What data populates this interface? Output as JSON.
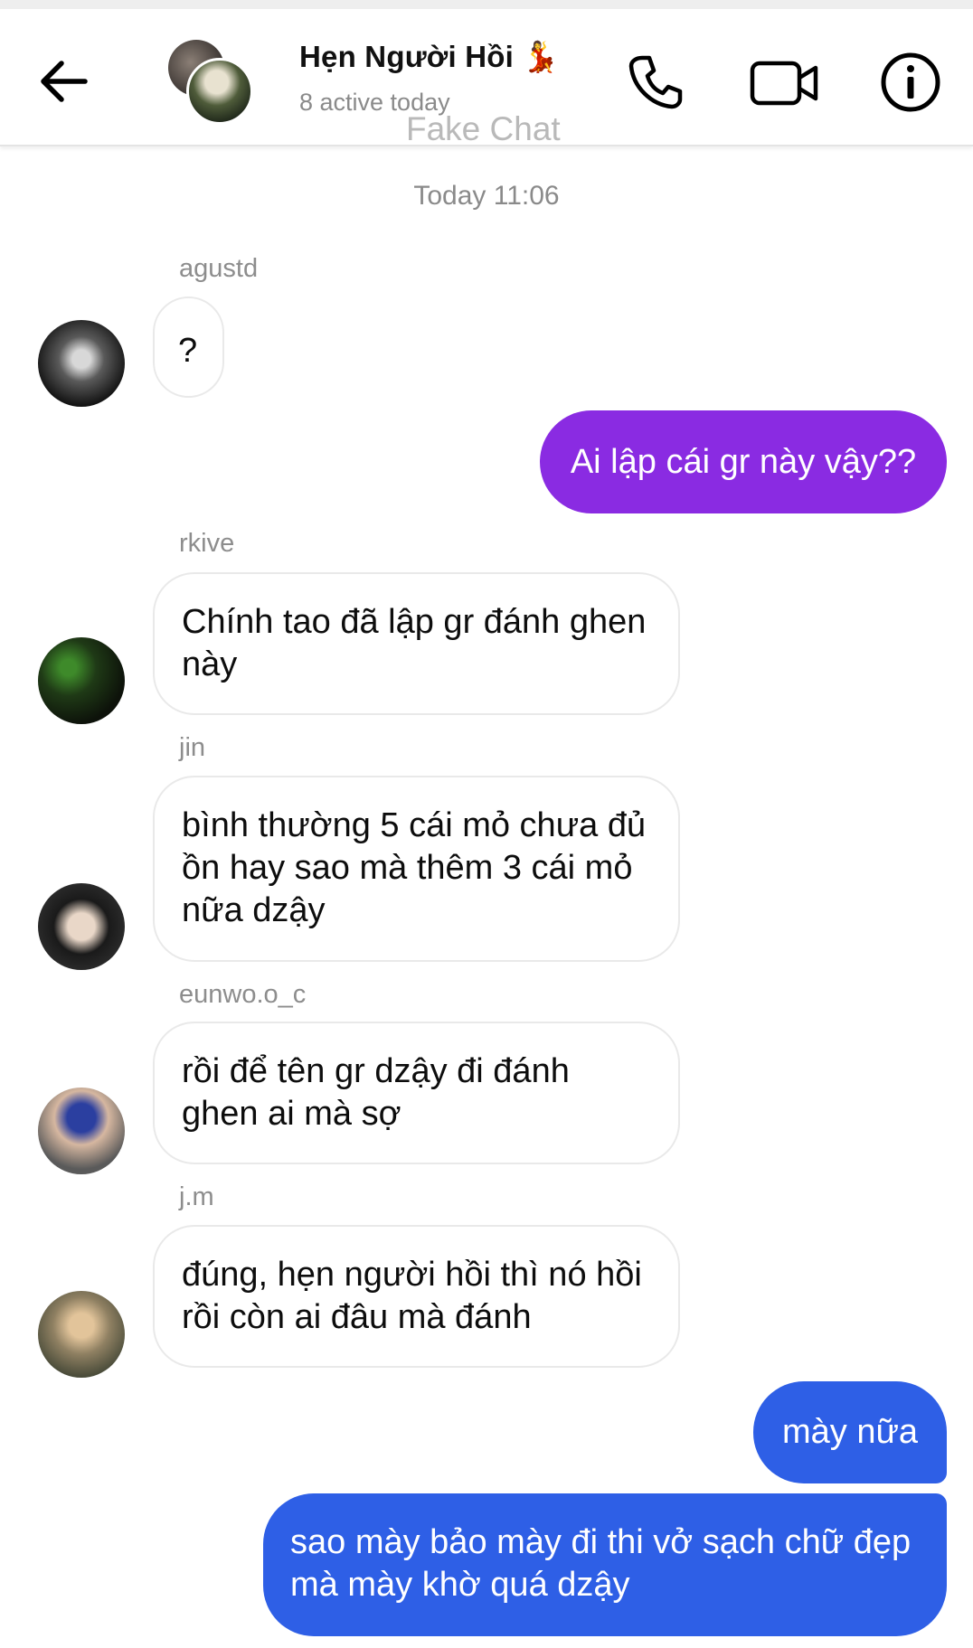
{
  "header": {
    "title": "Hẹn Người Hồi 💃",
    "subtitle": "8 active today",
    "watermark": "Fake Chat"
  },
  "icons": {
    "back": "back-arrow-icon",
    "call": "phone-icon",
    "video": "video-camera-icon",
    "info": "info-icon"
  },
  "colors": {
    "purple_bubble": "#8a2be2",
    "blue_bubble": "#2e5fe6",
    "incoming_border": "#e9e9e9"
  },
  "chat": {
    "timestamp": "Today 11:06",
    "messages": [
      {
        "sender": "agustd",
        "text": "?"
      },
      {
        "text": "Ai lập cái gr này vậy??"
      },
      {
        "sender": "rkive",
        "text": "Chính tao đã lập gr đánh ghen này"
      },
      {
        "sender": "jin",
        "text": "bình thường 5 cái mỏ chưa đủ ồn hay sao mà thêm 3 cái mỏ nữa dzậy"
      },
      {
        "sender": "eunwo.o_c",
        "text": "rồi để tên gr dzậy đi đánh ghen ai mà sợ"
      },
      {
        "sender": "j.m",
        "text": "đúng, hẹn người hồi thì nó hồi rồi còn ai đâu mà đánh"
      },
      {
        "text": "mày nữa"
      },
      {
        "text": "sao mày bảo mày đi thi vở sạch chữ đẹp mà mày khờ quá dzậy"
      }
    ]
  }
}
